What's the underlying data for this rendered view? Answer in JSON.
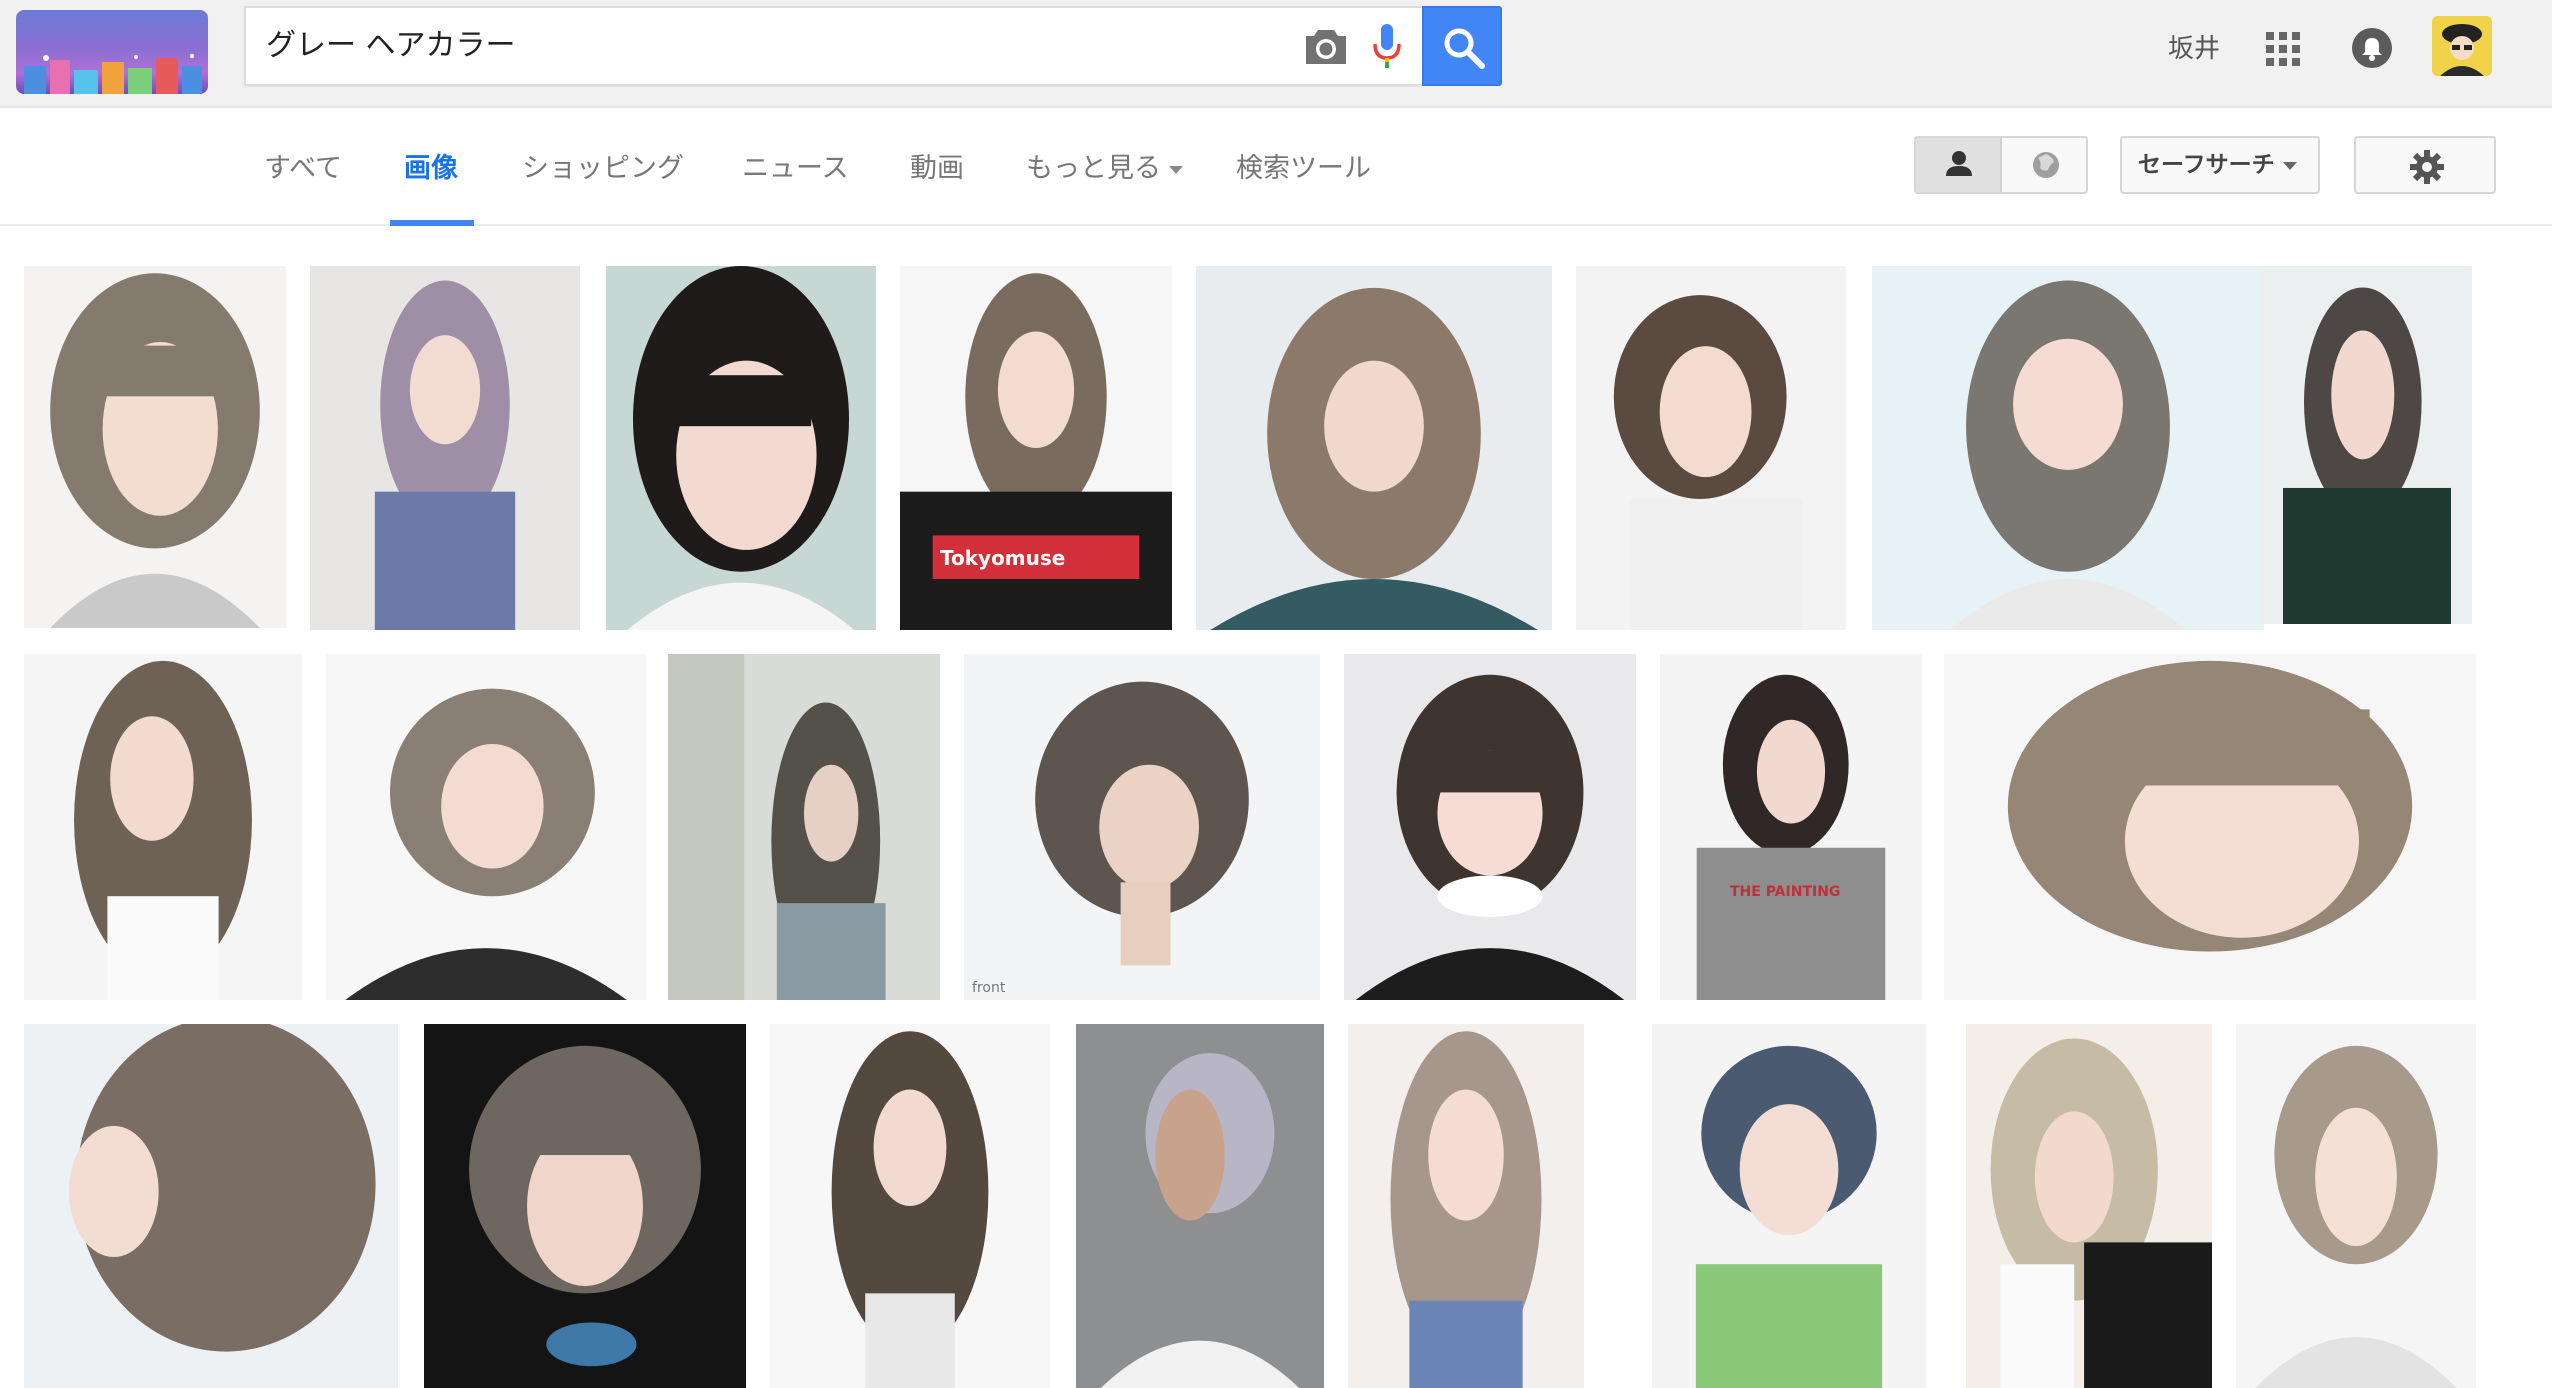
{
  "search": {
    "query": "グレー ヘアカラー"
  },
  "header": {
    "user_name": "坂井"
  },
  "tabs": [
    {
      "label": "すべて",
      "active": false
    },
    {
      "label": "画像",
      "active": true
    },
    {
      "label": "ショッピング",
      "active": false
    },
    {
      "label": "ニュース",
      "active": false
    },
    {
      "label": "動画",
      "active": false
    },
    {
      "label": "もっと見る",
      "active": false
    },
    {
      "label": "検索ツール",
      "active": false
    }
  ],
  "tools": {
    "safesearch_label": "セーフサーチ"
  },
  "colors": {
    "accent": "#4285f4",
    "header_bg": "#f1f1f1",
    "tab_active": "#1a73e8"
  },
  "icons": [
    "camera-icon",
    "mic-icon",
    "search-icon",
    "apps-icon",
    "notification-icon",
    "person-icon",
    "globe-icon",
    "gear-icon"
  ],
  "results": [
    {
      "caption": ""
    },
    {
      "caption": ""
    },
    {
      "caption": ""
    },
    {
      "caption": "Tokyomuse"
    },
    {
      "caption": ""
    },
    {
      "caption": ""
    },
    {
      "caption": ""
    },
    {
      "caption": ""
    },
    {
      "caption": ""
    },
    {
      "caption": ""
    },
    {
      "caption": ""
    },
    {
      "caption": "front"
    },
    {
      "caption": ""
    },
    {
      "caption": "THE PAINTING"
    },
    {
      "caption": ""
    },
    {
      "caption": ""
    },
    {
      "caption": ""
    },
    {
      "caption": ""
    },
    {
      "caption": ""
    },
    {
      "caption": ""
    },
    {
      "caption": ""
    },
    {
      "caption": ""
    },
    {
      "caption": ""
    }
  ]
}
